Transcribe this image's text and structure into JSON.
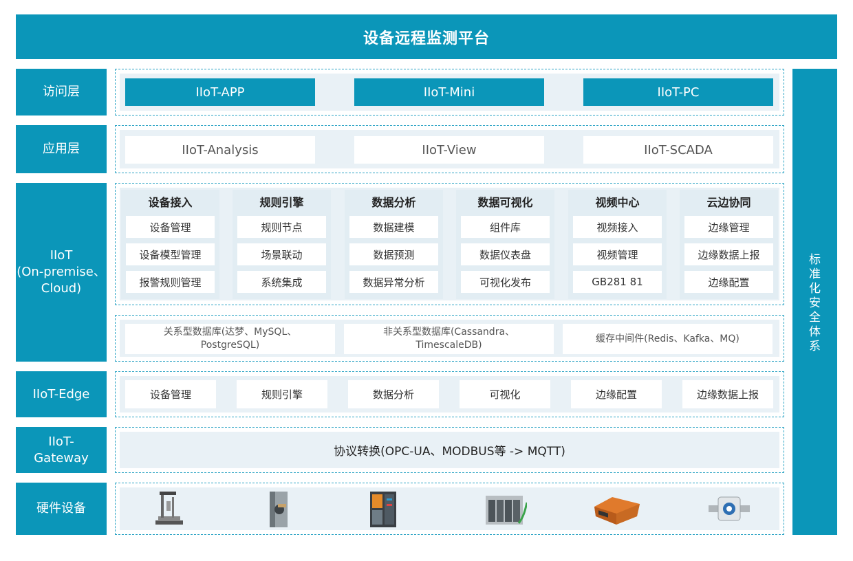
{
  "header": {
    "title": "设备远程监测平台"
  },
  "side": {
    "chars": [
      "标",
      "准",
      "化",
      "安",
      "全",
      "体",
      "系"
    ]
  },
  "layers": {
    "access": "访问层",
    "app": "应用层",
    "iiot": [
      "IIoT",
      "(On-premise、",
      "Cloud)"
    ],
    "edge": "IIoT-Edge",
    "gateway": [
      "IIoT-",
      "Gateway"
    ],
    "hardware": "硬件设备"
  },
  "access": [
    "IIoT-APP",
    "IIoT-Mini",
    "IIoT-PC"
  ],
  "application": [
    "IIoT-Analysis",
    "IIoT-View",
    "IIoT-SCADA"
  ],
  "modules": [
    {
      "title": "设备接入",
      "items": [
        "设备管理",
        "设备模型管理",
        "报警规则管理"
      ]
    },
    {
      "title": "规则引擎",
      "items": [
        "规则节点",
        "场景联动",
        "系统集成"
      ]
    },
    {
      "title": "数据分析",
      "items": [
        "数据建模",
        "数据预测",
        "数据异常分析"
      ]
    },
    {
      "title": "数据可视化",
      "items": [
        "组件库",
        "数据仪表盘",
        "可视化发布"
      ]
    },
    {
      "title": "视频中心",
      "items": [
        "视频接入",
        "视频管理",
        "GB281 81"
      ]
    },
    {
      "title": "云边协同",
      "items": [
        "边缘管理",
        "边缘数据上报",
        "边缘配置"
      ]
    }
  ],
  "databases": [
    [
      "关系型数据库(达梦、MySQL、",
      "PostgreSQL)"
    ],
    [
      "非关系型数据库(Cassandra、",
      "TimescaleDB)"
    ],
    [
      "缓存中间件(Redis、Kafka、MQ)"
    ]
  ],
  "edge": [
    "设备管理",
    "规则引擎",
    "数据分析",
    "可视化",
    "边缘配置",
    "边缘数据上报"
  ],
  "gateway": {
    "text": "协议转换(OPC-UA、MODBUS等 -> MQTT)"
  },
  "hardware": [
    "measuring-machine-icon",
    "sensor-probe-icon",
    "control-cabinet-icon",
    "plc-icon",
    "agv-robot-icon",
    "flow-sensor-icon"
  ],
  "colors": {
    "accent": "#0b96b9",
    "panel": "#e9f1f6",
    "dash": "#2aa3c4"
  }
}
